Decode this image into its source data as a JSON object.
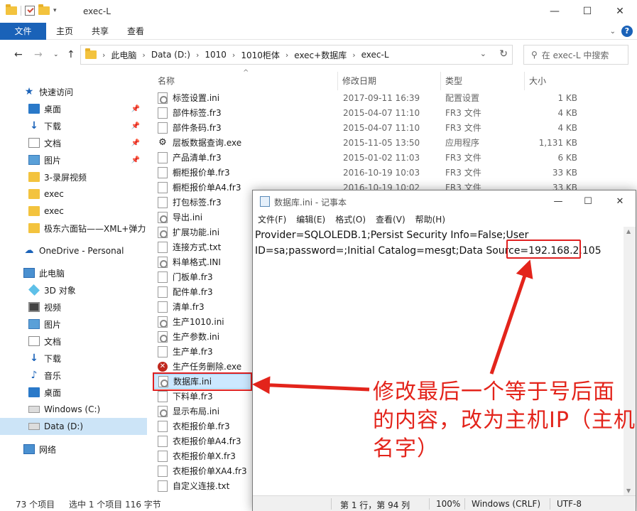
{
  "explorer": {
    "title": "exec-L",
    "window_buttons": {
      "minimize": "—",
      "maximize": "☐",
      "close": "✕"
    },
    "ribbon": {
      "tabs": [
        "文件",
        "主页",
        "共享",
        "查看"
      ]
    },
    "breadcrumb": [
      "此电脑",
      "Data (D:)",
      "1010",
      "1010柜体",
      "exec+数据库",
      "exec-L"
    ],
    "search_placeholder": "在 exec-L 中搜索",
    "columns": [
      "名称",
      "修改日期",
      "类型",
      "大小"
    ],
    "sidebar": [
      {
        "label": "快速访问",
        "icon": "star-icon"
      },
      {
        "label": "桌面",
        "icon": "desktop-icon",
        "pinned": true
      },
      {
        "label": "下载",
        "icon": "download-icon",
        "pinned": true
      },
      {
        "label": "文档",
        "icon": "document-icon",
        "pinned": true
      },
      {
        "label": "图片",
        "icon": "picture-icon",
        "pinned": true
      },
      {
        "label": "3-录屏视频",
        "icon": "folder-icon"
      },
      {
        "label": "exec",
        "icon": "folder-icon"
      },
      {
        "label": "exec",
        "icon": "folder-icon"
      },
      {
        "label": "极东六面钻——XML+弹力",
        "icon": "folder-icon"
      },
      {
        "label": "OneDrive - Personal",
        "icon": "cloud-icon"
      },
      {
        "label": "此电脑",
        "icon": "computer-icon"
      },
      {
        "label": "3D 对象",
        "icon": "3d-objects-icon"
      },
      {
        "label": "视频",
        "icon": "video-icon"
      },
      {
        "label": "图片",
        "icon": "picture-icon"
      },
      {
        "label": "文档",
        "icon": "document-icon"
      },
      {
        "label": "下载",
        "icon": "download-icon"
      },
      {
        "label": "音乐",
        "icon": "music-icon"
      },
      {
        "label": "桌面",
        "icon": "desktop-icon"
      },
      {
        "label": "Windows (C:)",
        "icon": "drive-icon"
      },
      {
        "label": "Data (D:)",
        "icon": "drive-icon",
        "selected": true
      },
      {
        "label": "网络",
        "icon": "network-icon"
      }
    ],
    "files": [
      {
        "name": "标签设置.ini",
        "date": "2017-09-11 16:39",
        "type": "配置设置",
        "size": "1 KB",
        "icon": "ini"
      },
      {
        "name": "部件标签.fr3",
        "date": "2015-04-07 11:10",
        "type": "FR3 文件",
        "size": "4 KB",
        "icon": "file"
      },
      {
        "name": "部件条码.fr3",
        "date": "2015-04-07 11:10",
        "type": "FR3 文件",
        "size": "4 KB",
        "icon": "file"
      },
      {
        "name": "层板数据查询.exe",
        "date": "2015-11-05 13:50",
        "type": "应用程序",
        "size": "1,131 KB",
        "icon": "exe"
      },
      {
        "name": "产品清单.fr3",
        "date": "2015-01-02 11:03",
        "type": "FR3 文件",
        "size": "6 KB",
        "icon": "file"
      },
      {
        "name": "橱柜报价单.fr3",
        "date": "2016-10-19 10:03",
        "type": "FR3 文件",
        "size": "33 KB",
        "icon": "file"
      },
      {
        "name": "橱柜报价单A4.fr3",
        "date": "2016-10-19 10:02",
        "type": "FR3 文件",
        "size": "33 KB",
        "icon": "file"
      },
      {
        "name": "打包标签.fr3",
        "date": "",
        "type": "",
        "size": "",
        "icon": "file"
      },
      {
        "name": "导出.ini",
        "date": "",
        "type": "",
        "size": "",
        "icon": "ini"
      },
      {
        "name": "扩展功能.ini",
        "date": "",
        "type": "",
        "size": "",
        "icon": "ini"
      },
      {
        "name": "连接方式.txt",
        "date": "",
        "type": "",
        "size": "",
        "icon": "file"
      },
      {
        "name": "料单格式.INI",
        "date": "",
        "type": "",
        "size": "",
        "icon": "ini"
      },
      {
        "name": "门板单.fr3",
        "date": "",
        "type": "",
        "size": "",
        "icon": "file"
      },
      {
        "name": "配件单.fr3",
        "date": "",
        "type": "",
        "size": "",
        "icon": "file"
      },
      {
        "name": "清单.fr3",
        "date": "",
        "type": "",
        "size": "",
        "icon": "file"
      },
      {
        "name": "生产1010.ini",
        "date": "",
        "type": "",
        "size": "",
        "icon": "ini"
      },
      {
        "name": "生产参数.ini",
        "date": "",
        "type": "",
        "size": "",
        "icon": "ini"
      },
      {
        "name": "生产单.fr3",
        "date": "",
        "type": "",
        "size": "",
        "icon": "file"
      },
      {
        "name": "生产任务删除.exe",
        "date": "",
        "type": "",
        "size": "",
        "icon": "err"
      },
      {
        "name": "数据库.ini",
        "date": "",
        "type": "",
        "size": "",
        "icon": "ini",
        "selected": true
      },
      {
        "name": "下料单.fr3",
        "date": "",
        "type": "",
        "size": "",
        "icon": "file"
      },
      {
        "name": "显示布局.ini",
        "date": "",
        "type": "",
        "size": "",
        "icon": "ini"
      },
      {
        "name": "衣柜报价单.fr3",
        "date": "",
        "type": "",
        "size": "",
        "icon": "file"
      },
      {
        "name": "衣柜报价单A4.fr3",
        "date": "",
        "type": "",
        "size": "",
        "icon": "file"
      },
      {
        "name": "衣柜报价单X.fr3",
        "date": "",
        "type": "",
        "size": "",
        "icon": "file"
      },
      {
        "name": "衣柜报价单XA4.fr3",
        "date": "",
        "type": "",
        "size": "",
        "icon": "file"
      },
      {
        "name": "自定义连接.txt",
        "date": "",
        "type": "",
        "size": "",
        "icon": "file"
      }
    ],
    "status": {
      "count": "73 个项目",
      "selection": "选中 1 个项目  116 字节"
    }
  },
  "notepad": {
    "title": "数据库.ini - 记事本",
    "menu": [
      "文件(F)",
      "编辑(E)",
      "格式(O)",
      "查看(V)",
      "帮助(H)"
    ],
    "line1": "Provider=SQLOLEDB.1;Persist Security Info=False;User",
    "line2_prefix": "ID=sa;password=;Initial Catalog=mesgt;Data Source=",
    "line2_ip": "192.168.2.105",
    "status": {
      "position": "第 1 行，第 94 列",
      "zoom": "100%",
      "eol": "Windows (CRLF)",
      "encoding": "UTF-8"
    }
  },
  "annotation": {
    "text": "修改最后一个等于号后面的内容，改为主机IP（主机名字）",
    "color": "#e3241b"
  }
}
